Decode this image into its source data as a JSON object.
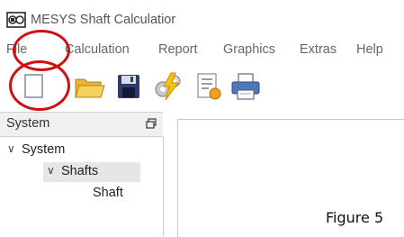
{
  "window": {
    "title": "MESYS Shaft Calculatior",
    "icon": "mesys-app-icon"
  },
  "menu": {
    "items": [
      {
        "key": "file",
        "label": "File"
      },
      {
        "key": "calculation",
        "label": "Calculation"
      },
      {
        "key": "report",
        "label": "Report"
      },
      {
        "key": "graphics",
        "label": "Graphics"
      },
      {
        "key": "extras",
        "label": "Extras"
      },
      {
        "key": "help",
        "label": "Help"
      }
    ]
  },
  "toolbar": {
    "buttons": [
      {
        "icon": "new-document-icon"
      },
      {
        "icon": "open-folder-icon"
      },
      {
        "icon": "save-disk-icon"
      },
      {
        "icon": "calculate-lightning-icon"
      },
      {
        "icon": "report-icon"
      },
      {
        "icon": "print-icon"
      }
    ]
  },
  "system_panel": {
    "title": "System",
    "tree": [
      {
        "label": "System",
        "expanded": true,
        "level": 0
      },
      {
        "label": "Shafts",
        "expanded": true,
        "level": 1,
        "highlighted": true
      },
      {
        "label": "Shaft",
        "level": 2
      }
    ]
  },
  "caption": "Figure 5",
  "colors": {
    "annotation": "#d01010",
    "menu_text": "#666666",
    "panel_header": "#f0f0f0",
    "tree_highlight": "#e6e6e6"
  }
}
